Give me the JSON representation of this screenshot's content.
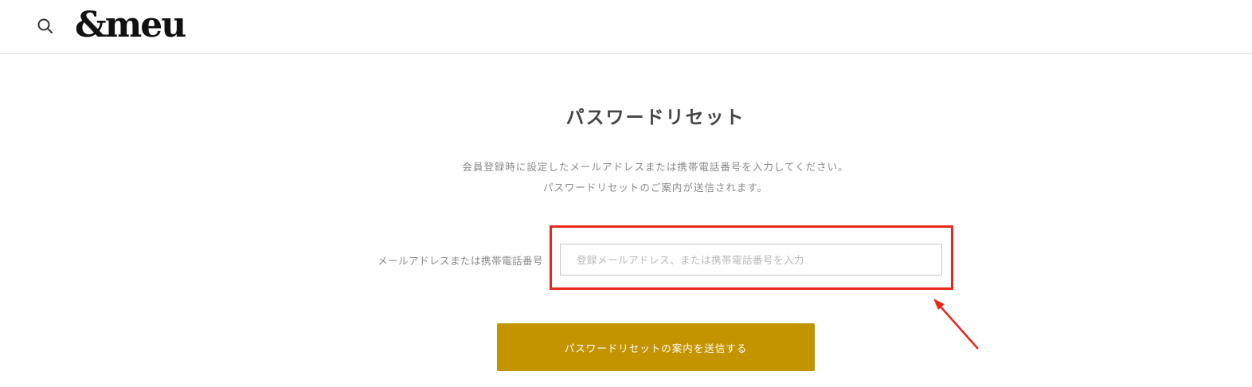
{
  "header": {
    "search_icon": "search-icon",
    "logo_text": "&meu"
  },
  "main": {
    "title": "パスワードリセット",
    "description_line1": "会員登録時に設定したメールアドレスまたは携帯電話番号を入力してください。",
    "description_line2": "パスワードリセットのご案内が送信されます。",
    "field_label": "メールアドレスまたは携帯電話番号",
    "field_value": "",
    "field_placeholder": "登録メールアドレス、または携帯電話番号を入力",
    "submit_label": "パスワードリセットの案内を送信する"
  },
  "colors": {
    "accent": "#c49300",
    "annotation": "#e8281c"
  }
}
